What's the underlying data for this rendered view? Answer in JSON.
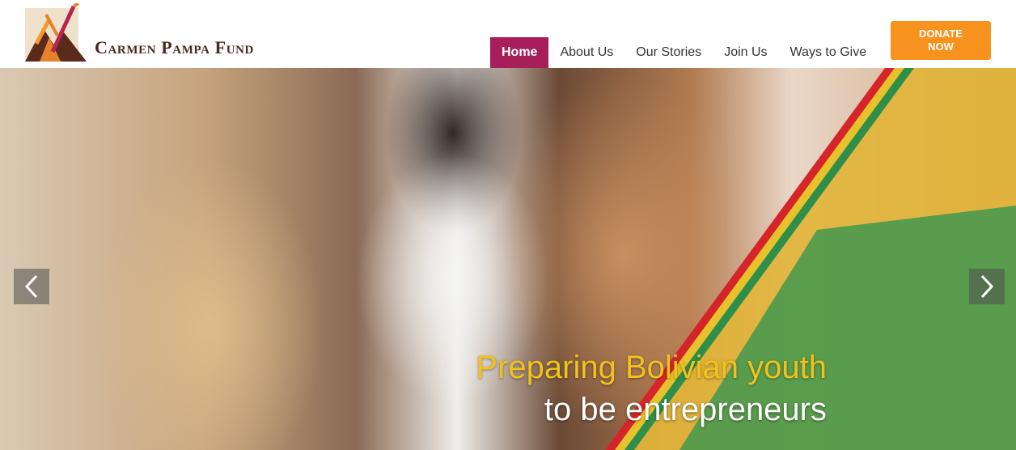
{
  "brand": {
    "name": "Carmen Pampa Fund",
    "colors": {
      "maroon": "#a61e5a",
      "orange": "#f7921e",
      "brown": "#4a2a1e"
    }
  },
  "nav": {
    "items": [
      {
        "label": "Home",
        "active": true
      },
      {
        "label": "About Us"
      },
      {
        "label": "Our Stories"
      },
      {
        "label": "Join Us"
      },
      {
        "label": "Ways to Give"
      }
    ],
    "donate": {
      "line1": "DONATE",
      "line2": "NOW"
    }
  },
  "hero": {
    "caption_line1": "Preparing Bolivian youth",
    "caption_line2": "to be entrepreneurs",
    "prev_icon": "chevron-left-icon",
    "next_icon": "chevron-right-icon"
  }
}
